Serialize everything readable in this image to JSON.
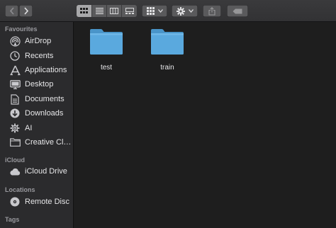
{
  "toolbar": {
    "back_icon": "chevron-left-icon",
    "forward_icon": "chevron-right-icon",
    "view_modes": [
      "icon-view",
      "list-view",
      "column-view",
      "gallery-view"
    ],
    "active_view": "icon-view",
    "group_icon": "grid-group-icon",
    "action_icon": "gear-icon",
    "share_icon": "share-icon",
    "tag_icon": "tag-icon"
  },
  "sidebar": {
    "sections": [
      {
        "title": "Favourites"
      },
      {
        "title": "iCloud"
      },
      {
        "title": "Locations"
      },
      {
        "title": "Tags"
      }
    ],
    "favourites": [
      {
        "label": "AirDrop",
        "icon": "airdrop-icon"
      },
      {
        "label": "Recents",
        "icon": "clock-icon"
      },
      {
        "label": "Applications",
        "icon": "applications-icon"
      },
      {
        "label": "Desktop",
        "icon": "desktop-icon"
      },
      {
        "label": "Documents",
        "icon": "document-icon"
      },
      {
        "label": "Downloads",
        "icon": "download-icon"
      },
      {
        "label": "AI",
        "icon": "gear-icon"
      },
      {
        "label": "Creative Cloud Files",
        "icon": "folder-icon"
      }
    ],
    "icloud": [
      {
        "label": "iCloud Drive",
        "icon": "cloud-icon"
      }
    ],
    "locations": [
      {
        "label": "Remote Disc",
        "icon": "disc-icon"
      }
    ]
  },
  "files": [
    {
      "name": "test",
      "icon": "folder-icon"
    },
    {
      "name": "train",
      "icon": "folder-icon"
    }
  ],
  "colors": {
    "folder": "#5aa9de",
    "sidebar_bg": "#2b2b2d",
    "content_bg": "#1e1e1e"
  }
}
